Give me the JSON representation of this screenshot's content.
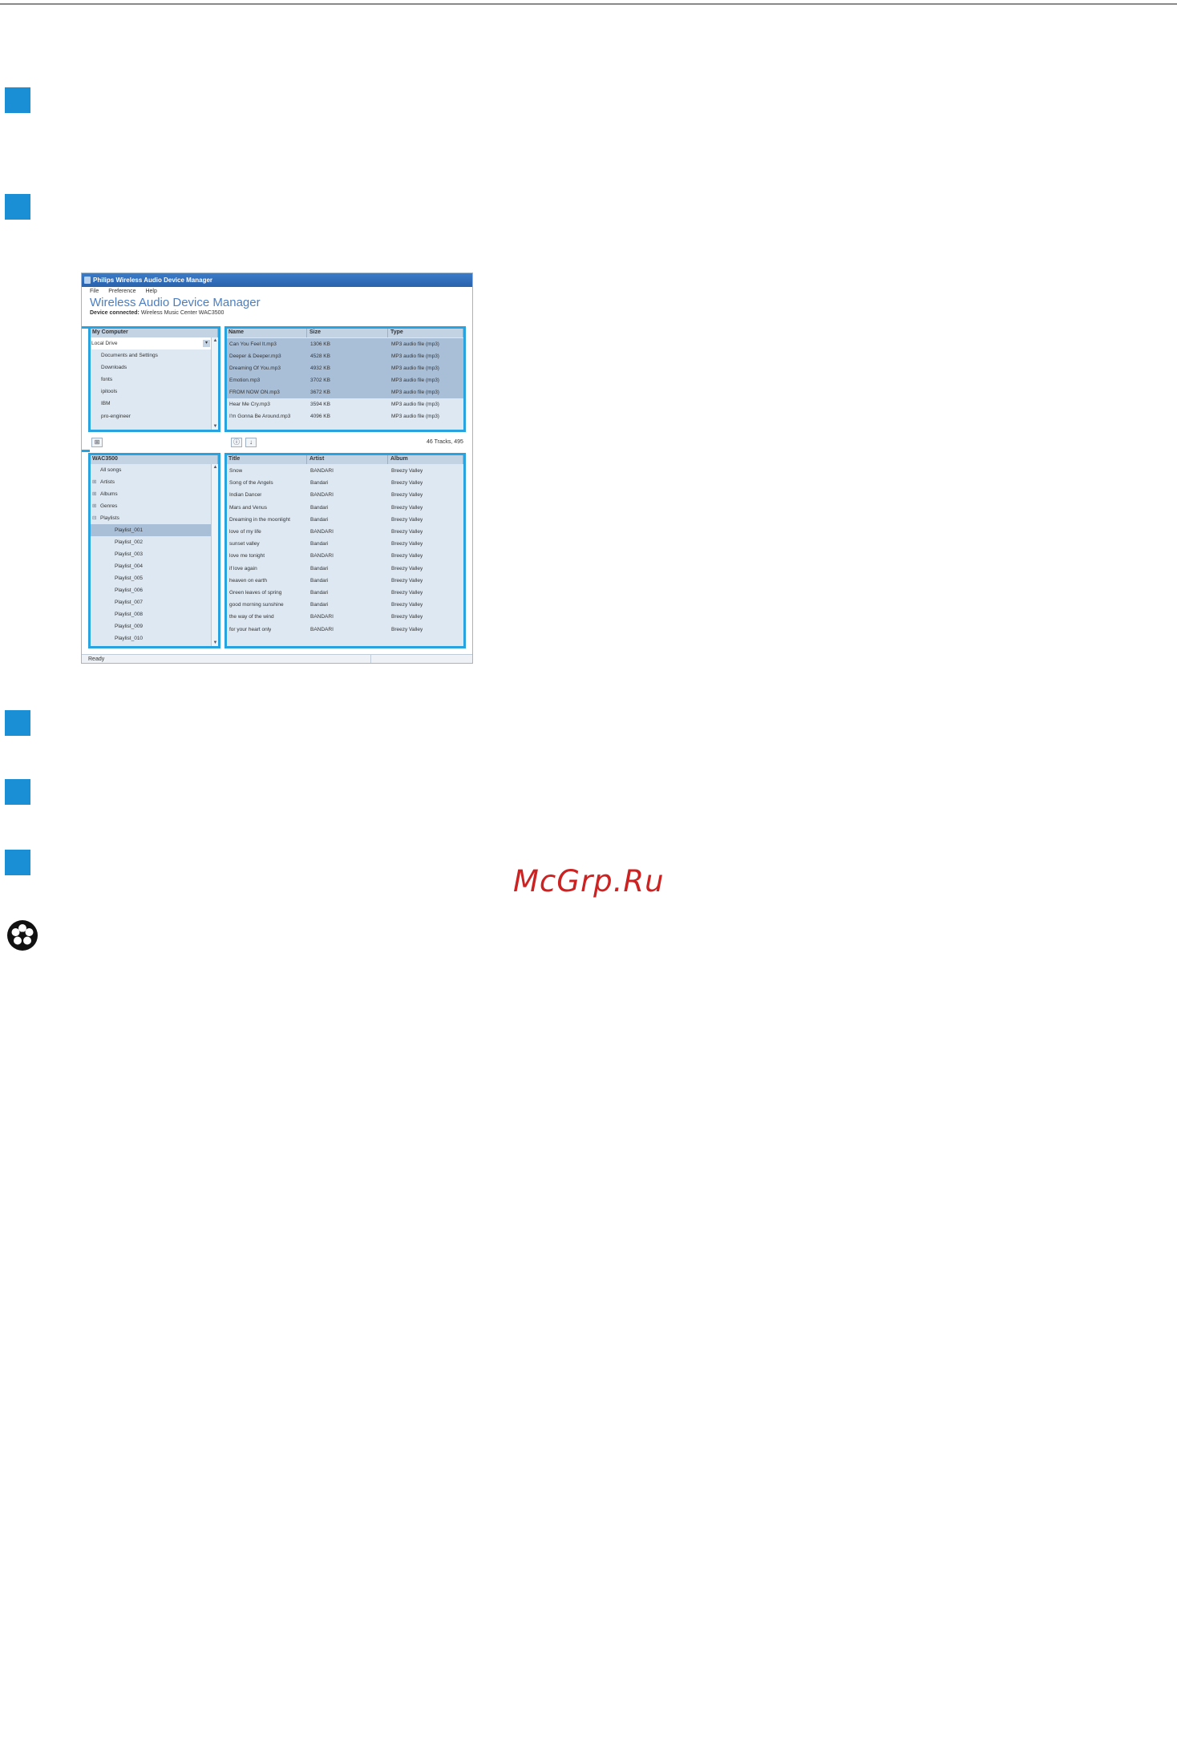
{
  "watermark": "McGrp.Ru",
  "app": {
    "window_title": "Philips Wireless Audio Device Manager",
    "menu": [
      "File",
      "Preference",
      "Help"
    ],
    "app_title": "Wireless Audio Device Manager",
    "device_label": "Device connected:",
    "device_value": "Wireless Music Center WAC3500",
    "computer_panel": {
      "header": "My Computer",
      "drive": "Local Drive",
      "folders": [
        "Documents and Settings",
        "Downloads",
        "fonts",
        "ipitools",
        "IBM",
        "pro-engineer"
      ]
    },
    "files_panel": {
      "columns": [
        "Name",
        "Size",
        "Type"
      ],
      "rows": [
        [
          "Can You Feel It.mp3",
          "1306 KB",
          "MP3 audio file (mp3)"
        ],
        [
          "Deeper & Deeper.mp3",
          "4528 KB",
          "MP3 audio file (mp3)"
        ],
        [
          "Dreaming Of You.mp3",
          "4932 KB",
          "MP3 audio file (mp3)"
        ],
        [
          "Emotion.mp3",
          "3702 KB",
          "MP3 audio file (mp3)"
        ],
        [
          "FROM NOW ON.mp3",
          "3672 KB",
          "MP3 audio file (mp3)"
        ],
        [
          "Hear Me Cry.mp3",
          "3594 KB",
          "MP3 audio file (mp3)"
        ],
        [
          "I'm Gonna Be Around.mp3",
          "4096 KB",
          "MP3 audio file (mp3)"
        ]
      ]
    },
    "tracks_summary": "46 Tracks, 495",
    "device_panel": {
      "header": "WAC3500",
      "items": [
        "All songs",
        "Artists",
        "Albums",
        "Genres",
        "Playlists"
      ],
      "playlists": [
        "Playlist_001",
        "Playlist_002",
        "Playlist_003",
        "Playlist_004",
        "Playlist_005",
        "Playlist_006",
        "Playlist_007",
        "Playlist_008",
        "Playlist_009",
        "Playlist_010"
      ]
    },
    "songs_panel": {
      "columns": [
        "Title",
        "Artist",
        "Album"
      ],
      "rows": [
        [
          "Snow",
          "BANDARI",
          "Breezy Valley"
        ],
        [
          "Song of the Angels",
          "Bandari",
          "Breezy Valley"
        ],
        [
          "Indian Dancer",
          "BANDARI",
          "Breezy Valley"
        ],
        [
          "Mars and Venus",
          "Bandari",
          "Breezy Valley"
        ],
        [
          "Dreaming in the moonlight",
          "Bandari",
          "Breezy Valley"
        ],
        [
          "love of my life",
          "BANDARI",
          "Breezy Valley"
        ],
        [
          "sunset valley",
          "Bandari",
          "Breezy Valley"
        ],
        [
          "love me tonight",
          "BANDARI",
          "Breezy Valley"
        ],
        [
          "if love again",
          "Bandari",
          "Breezy Valley"
        ],
        [
          "heaven on earth",
          "Bandari",
          "Breezy Valley"
        ],
        [
          "Green leaves of spring",
          "Bandari",
          "Breezy Valley"
        ],
        [
          "good morning sunshine",
          "Bandari",
          "Breezy Valley"
        ],
        [
          "the way of the wind",
          "BANDARI",
          "Breezy Valley"
        ],
        [
          "for your heart only",
          "BANDARI",
          "Breezy Valley"
        ]
      ]
    },
    "status": "Ready"
  }
}
